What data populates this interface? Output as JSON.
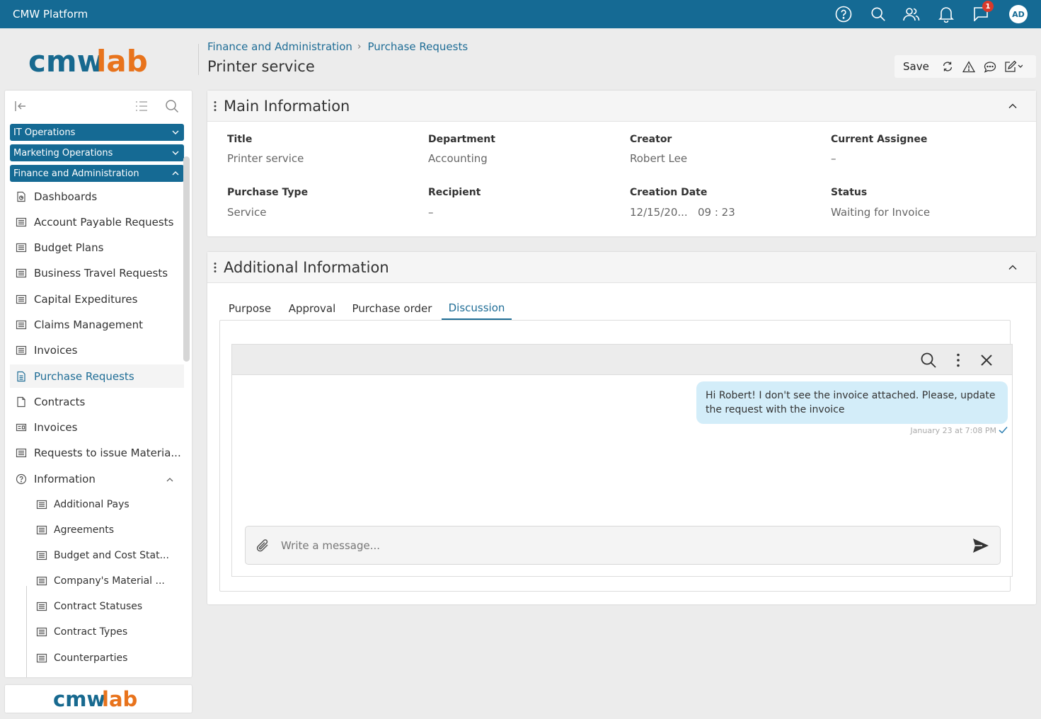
{
  "app": {
    "title": "CMW Platform",
    "notifications_count": "1",
    "avatar_initials": "AD"
  },
  "logo": {
    "part1": "cmw",
    "part2": "lab",
    "color1": "#17698f",
    "color2": "#e8731c"
  },
  "header": {
    "breadcrumb": [
      "Finance and Administration",
      "Purchase Requests"
    ],
    "title": "Printer service"
  },
  "toolbar": {
    "save_label": "Save"
  },
  "sidebar": {
    "groups": [
      {
        "label": "IT Operations",
        "expanded": false
      },
      {
        "label": "Marketing Operations",
        "expanded": false
      },
      {
        "label": "Finance and Administration",
        "expanded": true
      }
    ],
    "items": [
      {
        "label": "Dashboards",
        "icon": "dashboard-icon"
      },
      {
        "label": "Account Payable Requests",
        "icon": "list-icon"
      },
      {
        "label": "Budget Plans",
        "icon": "list-icon"
      },
      {
        "label": "Business Travel Requests",
        "icon": "list-icon"
      },
      {
        "label": "Capital Expeditures",
        "icon": "list-icon"
      },
      {
        "label": "Claims Management",
        "icon": "list-icon"
      },
      {
        "label": "Invoices",
        "icon": "list-icon"
      },
      {
        "label": "Purchase Requests",
        "icon": "document-icon",
        "active": true
      },
      {
        "label": "Contracts",
        "icon": "document-icon"
      },
      {
        "label": "Invoices",
        "icon": "card-icon"
      },
      {
        "label": "Requests to issue Materia...",
        "icon": "list-icon"
      },
      {
        "label": "Information",
        "icon": "help-circle-icon"
      }
    ],
    "subitems": [
      {
        "label": "Additional Pays"
      },
      {
        "label": "Agreements"
      },
      {
        "label": "Budget and Cost Stat..."
      },
      {
        "label": "Company's Material ..."
      },
      {
        "label": "Contract Statuses"
      },
      {
        "label": "Contract Types"
      },
      {
        "label": "Counterparties"
      }
    ]
  },
  "main_info": {
    "title": "Main Information",
    "fields": [
      {
        "label": "Title",
        "value": "Printer service"
      },
      {
        "label": "Department",
        "value": "Accounting"
      },
      {
        "label": "Creator",
        "value": "Robert Lee"
      },
      {
        "label": "Current Assignee",
        "value": "–"
      },
      {
        "label": "Purchase Type",
        "value": "Service"
      },
      {
        "label": "Recipient",
        "value": "–"
      },
      {
        "label": "Creation Date",
        "value": "12/15/20...   09 : 23"
      },
      {
        "label": "Status",
        "value": "Waiting for Invoice"
      }
    ]
  },
  "additional_info": {
    "title": "Additional Information",
    "tabs": [
      {
        "label": "Purpose"
      },
      {
        "label": "Approval"
      },
      {
        "label": "Purchase order"
      },
      {
        "label": "Discussion",
        "active": true
      }
    ],
    "discussion": {
      "message_text": "Hi Robert! I don't see the invoice attached. Please, update the request with the invoice",
      "message_time": "January 23 at 7:08 PM",
      "compose_placeholder": "Write a message..."
    }
  },
  "colors": {
    "topbar": "#156a94",
    "accent": "#1f6d96",
    "bubble": "#d3edf9"
  }
}
